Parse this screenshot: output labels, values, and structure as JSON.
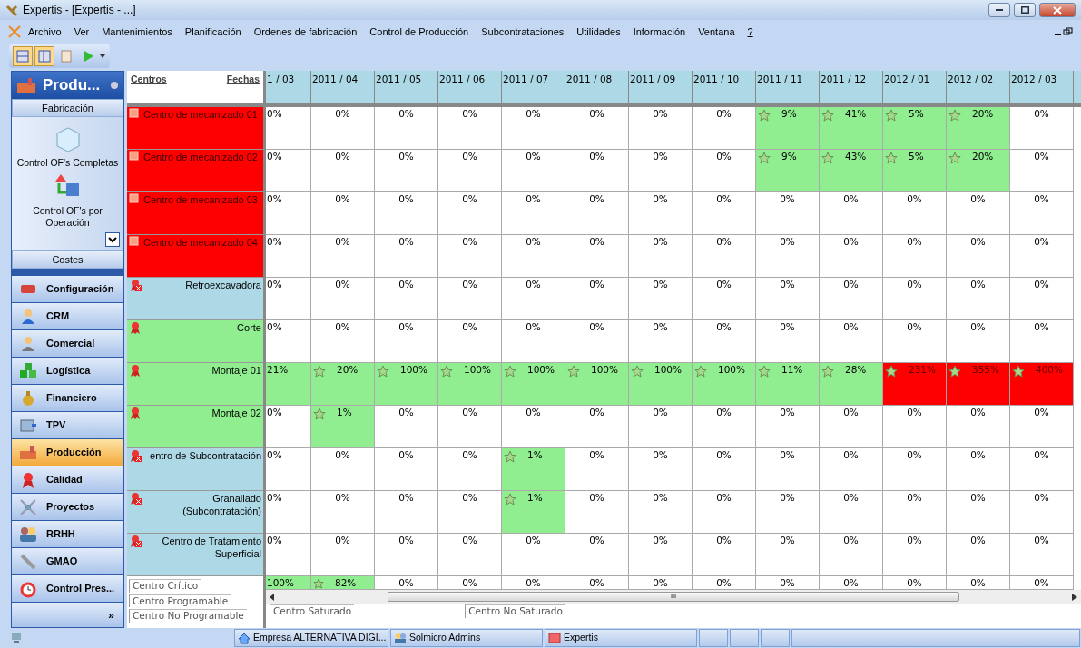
{
  "window": {
    "title": "Expertis - [Expertis - ...]"
  },
  "menu": [
    {
      "label": "Archivo"
    },
    {
      "label": "Ver"
    },
    {
      "label": "Mantenimientos"
    },
    {
      "label": "Planificación"
    },
    {
      "label": "Ordenes de fabricación"
    },
    {
      "label": "Control de Producción"
    },
    {
      "label": "Subcontrataciones"
    },
    {
      "label": "Utilidades"
    },
    {
      "label": "Información"
    },
    {
      "label": "Ventana"
    },
    {
      "label": "?"
    }
  ],
  "toolbar": [
    {
      "selected": true
    },
    {
      "selected": true
    },
    {
      "selected": false
    },
    {
      "selected": false
    }
  ],
  "sidebar": {
    "title": "Produ...",
    "group": "Fabricación",
    "items": [
      {
        "label": "Control OF's Completas"
      },
      {
        "label": "Control OF's por Operación"
      }
    ],
    "next_group": "Costes",
    "nav": [
      {
        "label": "Configuración",
        "selected": false
      },
      {
        "label": "CRM",
        "selected": false
      },
      {
        "label": "Comercial",
        "selected": false
      },
      {
        "label": "Logística",
        "selected": false
      },
      {
        "label": "Financiero",
        "selected": false
      },
      {
        "label": "TPV",
        "selected": false
      },
      {
        "label": "Producción",
        "selected": true
      },
      {
        "label": "Calidad",
        "selected": false
      },
      {
        "label": "Proyectos",
        "selected": false
      },
      {
        "label": "RRHH",
        "selected": false
      },
      {
        "label": "GMAO",
        "selected": false
      },
      {
        "label": "Control Pres...",
        "selected": false
      }
    ],
    "more": "»"
  },
  "grid": {
    "centers_header": "Centros",
    "dates_header": "Fechas",
    "columns": [
      "1 / 03",
      "2011 / 04",
      "2011 / 05",
      "2011 / 06",
      "2011 / 07",
      "2011 / 08",
      "2011 / 09",
      "2011 / 10",
      "2011 / 11",
      "2011 / 12",
      "2012 / 01",
      "2012 / 02",
      "2012 / 03"
    ],
    "rows": [
      {
        "name": "Centro de mecanizado 01",
        "kind": "critical",
        "cells": [
          {
            "value": "0%",
            "kind": "empty"
          },
          {
            "value": "0%",
            "kind": "empty"
          },
          {
            "value": "0%",
            "kind": "empty"
          },
          {
            "value": "0%",
            "kind": "empty"
          },
          {
            "value": "0%",
            "kind": "empty"
          },
          {
            "value": "0%",
            "kind": "empty"
          },
          {
            "value": "0%",
            "kind": "empty"
          },
          {
            "value": "0%",
            "kind": "empty"
          },
          {
            "value": "9%",
            "kind": "ok"
          },
          {
            "value": "41%",
            "kind": "ok"
          },
          {
            "value": "5%",
            "kind": "ok"
          },
          {
            "value": "20%",
            "kind": "ok"
          },
          {
            "value": "0%",
            "kind": "empty"
          }
        ]
      },
      {
        "name": "Centro de mecanizado 02",
        "kind": "critical",
        "cells": [
          {
            "value": "0%",
            "kind": "empty"
          },
          {
            "value": "0%",
            "kind": "empty"
          },
          {
            "value": "0%",
            "kind": "empty"
          },
          {
            "value": "0%",
            "kind": "empty"
          },
          {
            "value": "0%",
            "kind": "empty"
          },
          {
            "value": "0%",
            "kind": "empty"
          },
          {
            "value": "0%",
            "kind": "empty"
          },
          {
            "value": "0%",
            "kind": "empty"
          },
          {
            "value": "9%",
            "kind": "ok"
          },
          {
            "value": "43%",
            "kind": "ok"
          },
          {
            "value": "5%",
            "kind": "ok"
          },
          {
            "value": "20%",
            "kind": "ok"
          },
          {
            "value": "0%",
            "kind": "empty"
          }
        ]
      },
      {
        "name": "Centro de mecanizado 03",
        "kind": "critical",
        "cells": [
          {
            "value": "0%",
            "kind": "empty"
          },
          {
            "value": "0%",
            "kind": "empty"
          },
          {
            "value": "0%",
            "kind": "empty"
          },
          {
            "value": "0%",
            "kind": "empty"
          },
          {
            "value": "0%",
            "kind": "empty"
          },
          {
            "value": "0%",
            "kind": "empty"
          },
          {
            "value": "0%",
            "kind": "empty"
          },
          {
            "value": "0%",
            "kind": "empty"
          },
          {
            "value": "0%",
            "kind": "empty"
          },
          {
            "value": "0%",
            "kind": "empty"
          },
          {
            "value": "0%",
            "kind": "empty"
          },
          {
            "value": "0%",
            "kind": "empty"
          },
          {
            "value": "0%",
            "kind": "empty"
          }
        ]
      },
      {
        "name": "Centro de mecanizado 04",
        "kind": "critical",
        "cells": [
          {
            "value": "0%",
            "kind": "empty"
          },
          {
            "value": "0%",
            "kind": "empty"
          },
          {
            "value": "0%",
            "kind": "empty"
          },
          {
            "value": "0%",
            "kind": "empty"
          },
          {
            "value": "0%",
            "kind": "empty"
          },
          {
            "value": "0%",
            "kind": "empty"
          },
          {
            "value": "0%",
            "kind": "empty"
          },
          {
            "value": "0%",
            "kind": "empty"
          },
          {
            "value": "0%",
            "kind": "empty"
          },
          {
            "value": "0%",
            "kind": "empty"
          },
          {
            "value": "0%",
            "kind": "empty"
          },
          {
            "value": "0%",
            "kind": "empty"
          },
          {
            "value": "0%",
            "kind": "empty"
          }
        ]
      },
      {
        "name": "Retroexcavadora",
        "kind": "non_programmable",
        "cells": [
          {
            "value": "0%",
            "kind": "empty"
          },
          {
            "value": "0%",
            "kind": "empty"
          },
          {
            "value": "0%",
            "kind": "empty"
          },
          {
            "value": "0%",
            "kind": "empty"
          },
          {
            "value": "0%",
            "kind": "empty"
          },
          {
            "value": "0%",
            "kind": "empty"
          },
          {
            "value": "0%",
            "kind": "empty"
          },
          {
            "value": "0%",
            "kind": "empty"
          },
          {
            "value": "0%",
            "kind": "empty"
          },
          {
            "value": "0%",
            "kind": "empty"
          },
          {
            "value": "0%",
            "kind": "empty"
          },
          {
            "value": "0%",
            "kind": "empty"
          },
          {
            "value": "0%",
            "kind": "empty"
          }
        ]
      },
      {
        "name": "Corte",
        "kind": "programmable",
        "cells": [
          {
            "value": "0%",
            "kind": "empty"
          },
          {
            "value": "0%",
            "kind": "empty"
          },
          {
            "value": "0%",
            "kind": "empty"
          },
          {
            "value": "0%",
            "kind": "empty"
          },
          {
            "value": "0%",
            "kind": "empty"
          },
          {
            "value": "0%",
            "kind": "empty"
          },
          {
            "value": "0%",
            "kind": "empty"
          },
          {
            "value": "0%",
            "kind": "empty"
          },
          {
            "value": "0%",
            "kind": "empty"
          },
          {
            "value": "0%",
            "kind": "empty"
          },
          {
            "value": "0%",
            "kind": "empty"
          },
          {
            "value": "0%",
            "kind": "empty"
          },
          {
            "value": "0%",
            "kind": "empty"
          }
        ]
      },
      {
        "name": "Montaje 01",
        "kind": "programmable",
        "cells": [
          {
            "value": "21%",
            "kind": "ok"
          },
          {
            "value": "20%",
            "kind": "ok"
          },
          {
            "value": "100%",
            "kind": "ok"
          },
          {
            "value": "100%",
            "kind": "ok"
          },
          {
            "value": "100%",
            "kind": "ok"
          },
          {
            "value": "100%",
            "kind": "ok"
          },
          {
            "value": "100%",
            "kind": "ok"
          },
          {
            "value": "100%",
            "kind": "ok"
          },
          {
            "value": "11%",
            "kind": "ok"
          },
          {
            "value": "28%",
            "kind": "ok"
          },
          {
            "value": "231%",
            "kind": "over"
          },
          {
            "value": "355%",
            "kind": "over"
          },
          {
            "value": "400%",
            "kind": "over"
          }
        ]
      },
      {
        "name": "Montaje 02",
        "kind": "programmable",
        "cells": [
          {
            "value": "0%",
            "kind": "empty"
          },
          {
            "value": "1%",
            "kind": "ok"
          },
          {
            "value": "0%",
            "kind": "empty"
          },
          {
            "value": "0%",
            "kind": "empty"
          },
          {
            "value": "0%",
            "kind": "empty"
          },
          {
            "value": "0%",
            "kind": "empty"
          },
          {
            "value": "0%",
            "kind": "empty"
          },
          {
            "value": "0%",
            "kind": "empty"
          },
          {
            "value": "0%",
            "kind": "empty"
          },
          {
            "value": "0%",
            "kind": "empty"
          },
          {
            "value": "0%",
            "kind": "empty"
          },
          {
            "value": "0%",
            "kind": "empty"
          },
          {
            "value": "0%",
            "kind": "empty"
          }
        ]
      },
      {
        "name": "entro de Subcontratación",
        "kind": "non_programmable",
        "cells": [
          {
            "value": "0%",
            "kind": "empty"
          },
          {
            "value": "0%",
            "kind": "empty"
          },
          {
            "value": "0%",
            "kind": "empty"
          },
          {
            "value": "0%",
            "kind": "empty"
          },
          {
            "value": "1%",
            "kind": "ok"
          },
          {
            "value": "0%",
            "kind": "empty"
          },
          {
            "value": "0%",
            "kind": "empty"
          },
          {
            "value": "0%",
            "kind": "empty"
          },
          {
            "value": "0%",
            "kind": "empty"
          },
          {
            "value": "0%",
            "kind": "empty"
          },
          {
            "value": "0%",
            "kind": "empty"
          },
          {
            "value": "0%",
            "kind": "empty"
          },
          {
            "value": "0%",
            "kind": "empty"
          }
        ]
      },
      {
        "name": "Granallado (Subcontratación)",
        "kind": "non_programmable",
        "cells": [
          {
            "value": "0%",
            "kind": "empty"
          },
          {
            "value": "0%",
            "kind": "empty"
          },
          {
            "value": "0%",
            "kind": "empty"
          },
          {
            "value": "0%",
            "kind": "empty"
          },
          {
            "value": "1%",
            "kind": "ok"
          },
          {
            "value": "0%",
            "kind": "empty"
          },
          {
            "value": "0%",
            "kind": "empty"
          },
          {
            "value": "0%",
            "kind": "empty"
          },
          {
            "value": "0%",
            "kind": "empty"
          },
          {
            "value": "0%",
            "kind": "empty"
          },
          {
            "value": "0%",
            "kind": "empty"
          },
          {
            "value": "0%",
            "kind": "empty"
          },
          {
            "value": "0%",
            "kind": "empty"
          }
        ]
      },
      {
        "name": "Centro de Tratamiento Superficial",
        "kind": "non_programmable",
        "cells": [
          {
            "value": "0%",
            "kind": "empty"
          },
          {
            "value": "0%",
            "kind": "empty"
          },
          {
            "value": "0%",
            "kind": "empty"
          },
          {
            "value": "0%",
            "kind": "empty"
          },
          {
            "value": "0%",
            "kind": "empty"
          },
          {
            "value": "0%",
            "kind": "empty"
          },
          {
            "value": "0%",
            "kind": "empty"
          },
          {
            "value": "0%",
            "kind": "empty"
          },
          {
            "value": "0%",
            "kind": "empty"
          },
          {
            "value": "0%",
            "kind": "empty"
          },
          {
            "value": "0%",
            "kind": "empty"
          },
          {
            "value": "0%",
            "kind": "empty"
          },
          {
            "value": "0%",
            "kind": "empty"
          }
        ]
      },
      {
        "cells": [
          {
            "value": "100%",
            "kind": "ok"
          },
          {
            "value": "82%",
            "kind": "ok"
          },
          {
            "value": "0%",
            "kind": "empty"
          },
          {
            "value": "0%",
            "kind": "empty"
          },
          {
            "value": "0%",
            "kind": "empty"
          },
          {
            "value": "0%",
            "kind": "empty"
          },
          {
            "value": "0%",
            "kind": "empty"
          },
          {
            "value": "0%",
            "kind": "empty"
          },
          {
            "value": "0%",
            "kind": "empty"
          },
          {
            "value": "0%",
            "kind": "empty"
          },
          {
            "value": "0%",
            "kind": "empty"
          },
          {
            "value": "0%",
            "kind": "empty"
          },
          {
            "value": "0%",
            "kind": "empty"
          }
        ]
      }
    ],
    "center_legend": [
      "Centro Crítico",
      "Centro Programable",
      "Centro No Programable"
    ],
    "load_legend": [
      "Centro Saturado",
      "Centro No Saturado"
    ],
    "scroll_grip": "III"
  },
  "status_bar": [
    "Empresa ALTERNATIVA DIGI...",
    "Solmicro Admins",
    "Expertis"
  ]
}
